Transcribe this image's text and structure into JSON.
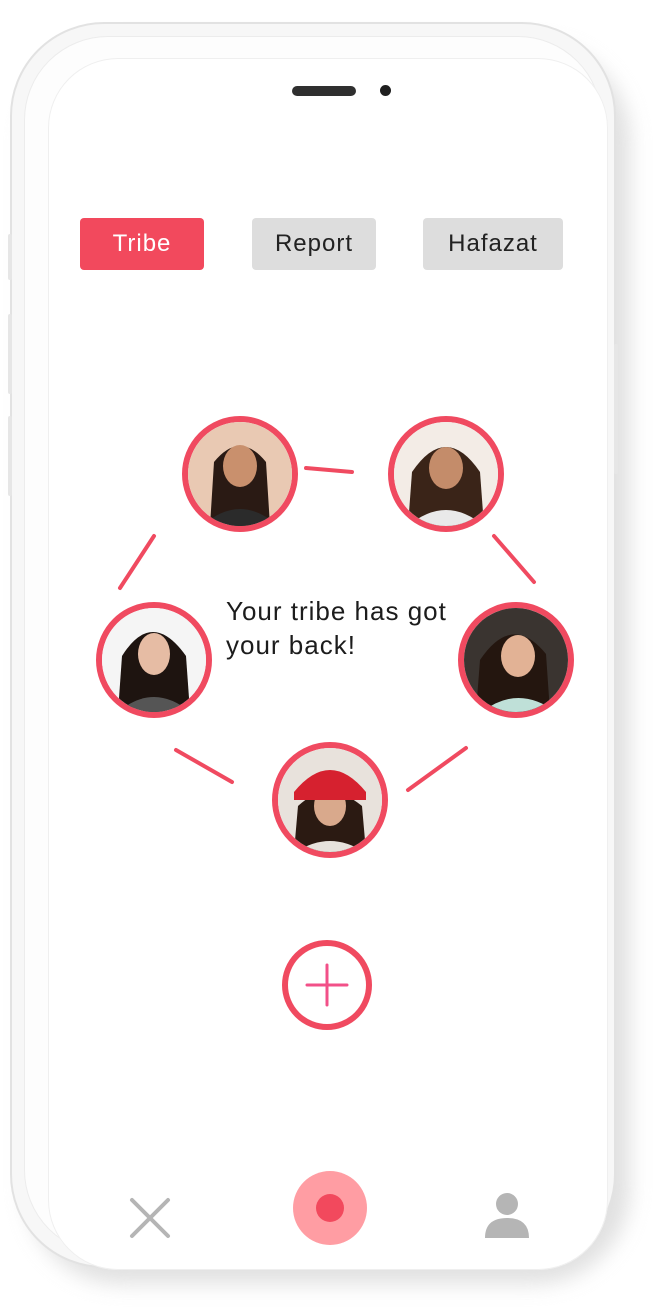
{
  "tabs": [
    {
      "label": "Tribe",
      "active": true
    },
    {
      "label": "Report",
      "active": false
    },
    {
      "label": "Hafazat",
      "active": false
    }
  ],
  "tribe": {
    "tagline": "Your tribe has got your back!",
    "members": [
      {
        "name": "member-1",
        "hair": "#2a1a14",
        "top": "#2b2b2b"
      },
      {
        "name": "member-2",
        "hair": "#3a2418",
        "top": "#e9e9e9"
      },
      {
        "name": "member-3",
        "hair": "#1e1410",
        "top": "#555555"
      },
      {
        "name": "member-4",
        "hair": "#24160f",
        "top": "#bfe0d8"
      },
      {
        "name": "member-5",
        "hair": "#2b1a12",
        "top": "#e7e2dc",
        "hat": "#d6212f"
      }
    ]
  },
  "actions": {
    "add_icon": "plus-icon"
  },
  "bottom_nav": {
    "close_icon": "close-icon",
    "record_icon": "record-icon",
    "profile_icon": "user-icon"
  },
  "colors": {
    "accent": "#f2495d",
    "tab_inactive": "#dddddd",
    "record_outer": "#ff9da3",
    "record_inner": "#f2495d",
    "nav_grey": "#b5b5b5"
  }
}
